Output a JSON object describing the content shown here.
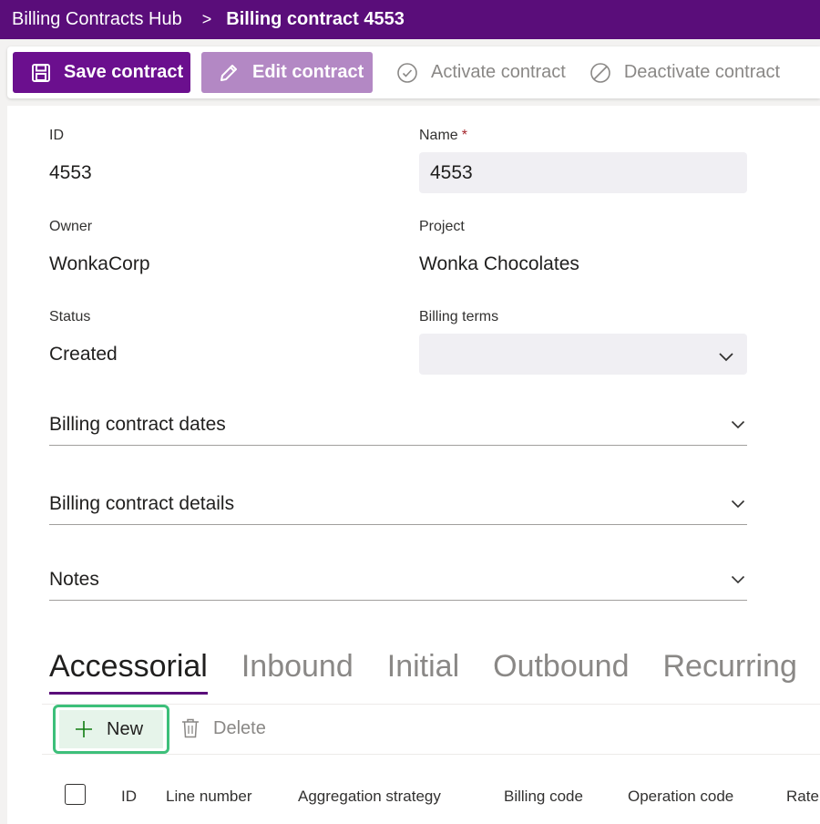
{
  "header": {
    "app_name": "Billing Contracts Hub",
    "separator": ">",
    "current_page": "Billing contract 4553",
    "color": "#5a0d7a"
  },
  "toolbar": {
    "save_label": "Save contract",
    "edit_label": "Edit contract",
    "activate_label": "Activate contract",
    "deactivate_label": "Deactivate contract"
  },
  "form": {
    "id_label": "ID",
    "id_value": "4553",
    "name_label": "Name",
    "name_required": "*",
    "name_value": "4553",
    "owner_label": "Owner",
    "owner_value": "WonkaCorp",
    "project_label": "Project",
    "project_value": "Wonka Chocolates",
    "status_label": "Status",
    "status_value": "Created",
    "billing_terms_label": "Billing terms",
    "billing_terms_value": ""
  },
  "sections": [
    {
      "title": "Billing contract dates"
    },
    {
      "title": "Billing contract details"
    },
    {
      "title": "Notes"
    }
  ],
  "tabs": [
    {
      "label": "Accessorial",
      "active": true
    },
    {
      "label": "Inbound",
      "active": false
    },
    {
      "label": "Initial",
      "active": false
    },
    {
      "label": "Outbound",
      "active": false
    },
    {
      "label": "Recurring",
      "active": false
    }
  ],
  "grid": {
    "new_label": "New",
    "delete_label": "Delete",
    "columns": [
      "ID",
      "Line number",
      "Aggregation strategy",
      "Billing code",
      "Operation code",
      "Rate"
    ]
  },
  "icons": {
    "save": "save-icon",
    "edit": "pencil-icon",
    "activate": "check-circle-icon",
    "deactivate": "block-icon",
    "chevron": "chevron-down-icon",
    "add": "plus-icon",
    "delete": "trash-icon"
  },
  "colors": {
    "accent": "#6b0f8e",
    "highlight": "#3dbf7a"
  }
}
